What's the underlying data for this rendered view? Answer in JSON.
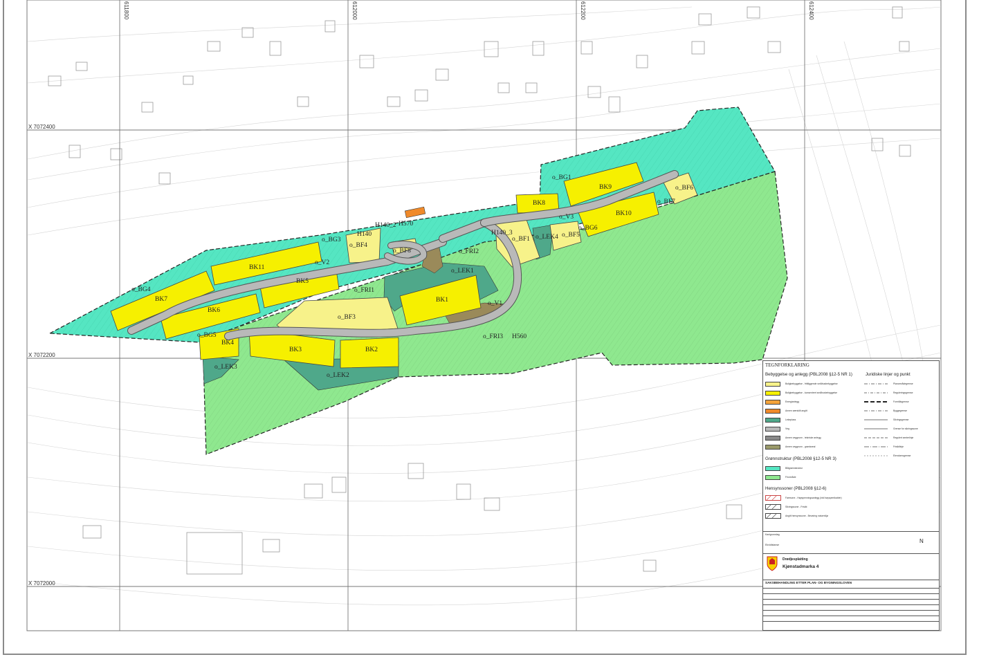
{
  "grid_labels": {
    "x_lines": [
      "X 7072400",
      "X 7072200",
      "X 7072000"
    ],
    "y_lines": [
      "611800",
      "612000",
      "612200",
      "612400"
    ]
  },
  "zones": {
    "residential": [
      "BK1",
      "BK2",
      "BK3",
      "BK4",
      "BK5",
      "BK6",
      "BK7",
      "BK8",
      "BK9",
      "BK10",
      "BK11"
    ],
    "free_detached": [
      "o_BF1",
      "o_BF3",
      "o_BF4",
      "o_BF5",
      "o_BF6",
      "o_BF7",
      "o_BF8"
    ],
    "green": [
      "o_BG1",
      "o_BG3",
      "o_BG4",
      "o_BG5",
      "o_BG6"
    ],
    "play": [
      "o_LEK1",
      "o_LEK2",
      "o_LEK3",
      "o_LEK4"
    ],
    "open_space": [
      "o_FRI1",
      "o_FRI2",
      "o_FRI3"
    ],
    "roads": [
      "o_V1",
      "o_V2",
      "o_V3"
    ],
    "hazard": [
      "H140",
      "H140_3",
      "H140_2",
      "H570",
      "H560"
    ]
  },
  "legend": {
    "title": "TEGNFORKLARING",
    "section1": "Bebyggelse og anlegg (PBL2008 §12-5 NR 1)",
    "section2": "Juridiske linjer og punkt",
    "section3": "Grønnstruktur (PBL2008 §12-5 NR 3)",
    "section4": "Hensynssoner (PBL2008 §12-6)",
    "entries1": [
      {
        "label": "Boligbebyggelse - frittliggende småhusbebyggelse",
        "color": "#f7f28a"
      },
      {
        "label": "Boligbebyggelse - konsentrert småhusbebyggelse",
        "color": "#f6f000"
      },
      {
        "label": "Energianlegg",
        "color": "#f4a33a"
      },
      {
        "label": "Annen særskilt angitt",
        "color": "#f08a2a"
      },
      {
        "label": "Lekeplass",
        "color": "#4fa88a"
      },
      {
        "label": "Veg",
        "color": "#b9b9b9"
      },
      {
        "label": "Annen veggrunn - tekniske anlegg",
        "color": "#8a8a8a"
      },
      {
        "label": "Annen veggrunn - grøntareal",
        "color": "#9a9a6a"
      }
    ],
    "entries_lines": [
      "Planområdegrense",
      "Reguleringsgrense",
      "Formålsgrense",
      "Byggegrense",
      "Sikringsgrense",
      "Grense for sikringssone",
      "Regulert senterlinje",
      "Frisiktlinje",
      "Eiendomsgrense"
    ],
    "entries3": [
      {
        "label": "Blågrønnstruktur",
        "color": "#55e6c2"
      },
      {
        "label": "Friområde",
        "color": "#8fe88f"
      }
    ],
    "entries4": [
      "Faresone - Høyspenningsanlegg (inkl høyspentkabler)",
      "Sikringssone - Frisikt",
      "Angitt hensynssone - Bevaring naturmiljø"
    ],
    "note1": "Kartgrunnlag",
    "note2": "Ekvidistanse",
    "municipality": "Drødjesplatting",
    "plan_name": "Kjønstadmarka 4",
    "saks": "SAKSBEHANDLING ETTER PLAN- OG BYGNINGSLOVEN",
    "north_arrow": "N"
  },
  "colors": {
    "yellow": "#f6f000",
    "pale_yellow": "#f7f28a",
    "turquoise": "#55e6c2",
    "green": "#8fe88f",
    "dark_green": "#4fa88a",
    "road": "#b9b9b9",
    "brown": "#9a8a5a",
    "orange": "#f08a2a"
  }
}
